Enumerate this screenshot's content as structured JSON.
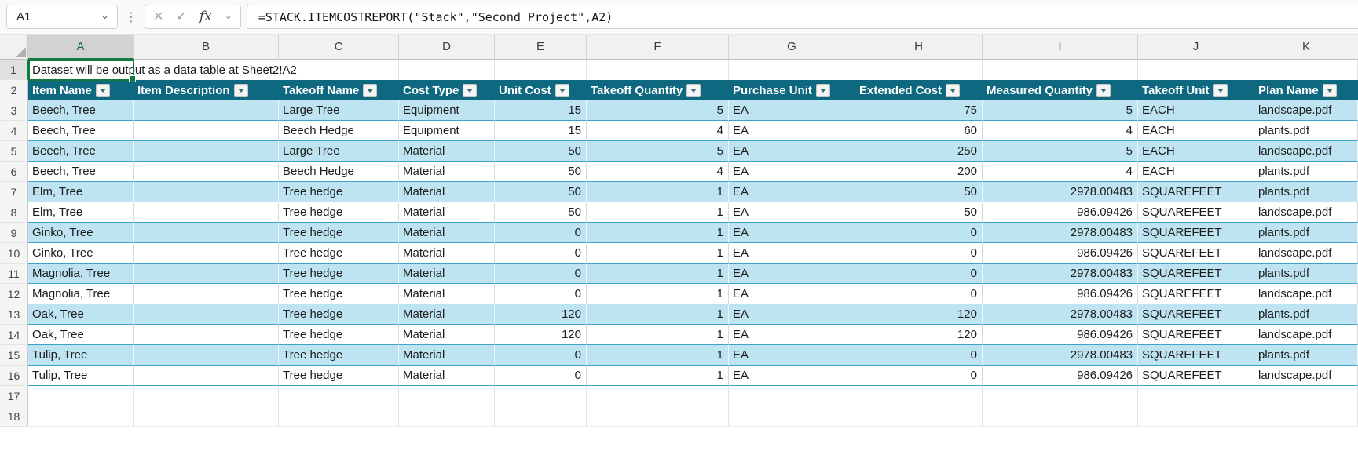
{
  "formula_bar": {
    "name_box_value": "A1",
    "cancel_label": "✕",
    "enter_label": "✓",
    "fx_label": "fx",
    "formula": "=STACK.ITEMCOSTREPORT(\"Stack\",\"Second Project\",A2)"
  },
  "sheet": {
    "selected_cell": "A1",
    "column_letters": [
      "A",
      "B",
      "C",
      "D",
      "E",
      "F",
      "G",
      "H",
      "I",
      "J",
      "K"
    ],
    "visible_rows": [
      "1",
      "2",
      "3",
      "4",
      "5",
      "6",
      "7",
      "8",
      "9",
      "10",
      "11",
      "12",
      "13",
      "14",
      "15",
      "16",
      "17",
      "18"
    ],
    "row1_text": "Dataset will be output as a data table at Sheet2!A2",
    "table": {
      "headers": [
        "Item Name",
        "Item Description",
        "Takeoff Name",
        "Cost Type",
        "Unit Cost",
        "Takeoff Quantity",
        "Purchase Unit",
        "Extended Cost",
        "Measured Quantity",
        "Takeoff Unit",
        "Plan Name"
      ],
      "rows": [
        [
          "Beech, Tree",
          "",
          "Large Tree",
          "Equipment",
          "15",
          "5",
          "EA",
          "75",
          "5",
          "EACH",
          "landscape.pdf"
        ],
        [
          "Beech, Tree",
          "",
          "Beech Hedge",
          "Equipment",
          "15",
          "4",
          "EA",
          "60",
          "4",
          "EACH",
          "plants.pdf"
        ],
        [
          "Beech, Tree",
          "",
          "Large Tree",
          "Material",
          "50",
          "5",
          "EA",
          "250",
          "5",
          "EACH",
          "landscape.pdf"
        ],
        [
          "Beech, Tree",
          "",
          "Beech Hedge",
          "Material",
          "50",
          "4",
          "EA",
          "200",
          "4",
          "EACH",
          "plants.pdf"
        ],
        [
          "Elm, Tree",
          "",
          "Tree hedge",
          "Material",
          "50",
          "1",
          "EA",
          "50",
          "2978.00483",
          "SQUAREFEET",
          "plants.pdf"
        ],
        [
          "Elm, Tree",
          "",
          "Tree hedge",
          "Material",
          "50",
          "1",
          "EA",
          "50",
          "986.09426",
          "SQUAREFEET",
          "landscape.pdf"
        ],
        [
          "Ginko, Tree",
          "",
          "Tree hedge",
          "Material",
          "0",
          "1",
          "EA",
          "0",
          "2978.00483",
          "SQUAREFEET",
          "plants.pdf"
        ],
        [
          "Ginko, Tree",
          "",
          "Tree hedge",
          "Material",
          "0",
          "1",
          "EA",
          "0",
          "986.09426",
          "SQUAREFEET",
          "landscape.pdf"
        ],
        [
          "Magnolia, Tree",
          "",
          "Tree hedge",
          "Material",
          "0",
          "1",
          "EA",
          "0",
          "2978.00483",
          "SQUAREFEET",
          "plants.pdf"
        ],
        [
          "Magnolia, Tree",
          "",
          "Tree hedge",
          "Material",
          "0",
          "1",
          "EA",
          "0",
          "986.09426",
          "SQUAREFEET",
          "landscape.pdf"
        ],
        [
          "Oak, Tree",
          "",
          "Tree hedge",
          "Material",
          "120",
          "1",
          "EA",
          "120",
          "2978.00483",
          "SQUAREFEET",
          "plants.pdf"
        ],
        [
          "Oak, Tree",
          "",
          "Tree hedge",
          "Material",
          "120",
          "1",
          "EA",
          "120",
          "986.09426",
          "SQUAREFEET",
          "landscape.pdf"
        ],
        [
          "Tulip, Tree",
          "",
          "Tree hedge",
          "Material",
          "0",
          "1",
          "EA",
          "0",
          "2978.00483",
          "SQUAREFEET",
          "plants.pdf"
        ],
        [
          "Tulip, Tree",
          "",
          "Tree hedge",
          "Material",
          "0",
          "1",
          "EA",
          "0",
          "986.09426",
          "SQUAREFEET",
          "landscape.pdf"
        ]
      ]
    }
  },
  "colors": {
    "table_header_bg": "#0E6880",
    "band_row_bg": "#BEE4F2",
    "band_border": "#3EA4C7",
    "selection_green": "#107C41",
    "header_text": "#FFFFFF"
  }
}
